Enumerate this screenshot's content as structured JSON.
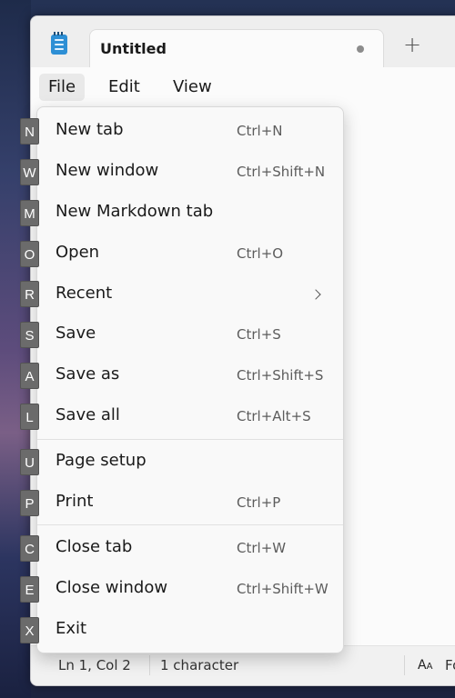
{
  "window": {
    "tab_title": "Untitled",
    "new_tab_glyph": "+",
    "app_icon": "notepad-icon"
  },
  "menubar": {
    "items": [
      {
        "label": "File"
      },
      {
        "label": "Edit"
      },
      {
        "label": "View"
      }
    ]
  },
  "file_menu": {
    "items": [
      {
        "label": "New tab",
        "shortcut": "Ctrl+N",
        "key_tip": "N"
      },
      {
        "label": "New window",
        "shortcut": "Ctrl+Shift+N",
        "key_tip": "W"
      },
      {
        "label": "New Markdown tab",
        "shortcut": "",
        "key_tip": "M"
      },
      {
        "label": "Open",
        "shortcut": "Ctrl+O",
        "key_tip": "O"
      },
      {
        "label": "Recent",
        "shortcut": "",
        "key_tip": "R",
        "submenu_icon": "chevron-right-icon"
      },
      {
        "label": "Save",
        "shortcut": "Ctrl+S",
        "key_tip": "S"
      },
      {
        "label": "Save as",
        "shortcut": "Ctrl+Shift+S",
        "key_tip": "A"
      },
      {
        "label": "Save all",
        "shortcut": "Ctrl+Alt+S",
        "key_tip": "L"
      },
      {
        "label": "Page setup",
        "shortcut": "",
        "key_tip": "U"
      },
      {
        "label": "Print",
        "shortcut": "Ctrl+P",
        "key_tip": "P"
      },
      {
        "label": "Close tab",
        "shortcut": "Ctrl+W",
        "key_tip": "C"
      },
      {
        "label": "Close window",
        "shortcut": "Ctrl+Shift+W",
        "key_tip": "E"
      },
      {
        "label": "Exit",
        "shortcut": "",
        "key_tip": "X"
      }
    ]
  },
  "statusbar": {
    "position": "Ln 1, Col 2",
    "characters": "1 character",
    "font_icon": "text-size-icon",
    "font_label": "Fo"
  },
  "colors": {
    "key_tip_bg": "#6b6b6b",
    "menu_bg": "#f9f9f9",
    "tab_dot": "#8c8c8c"
  }
}
